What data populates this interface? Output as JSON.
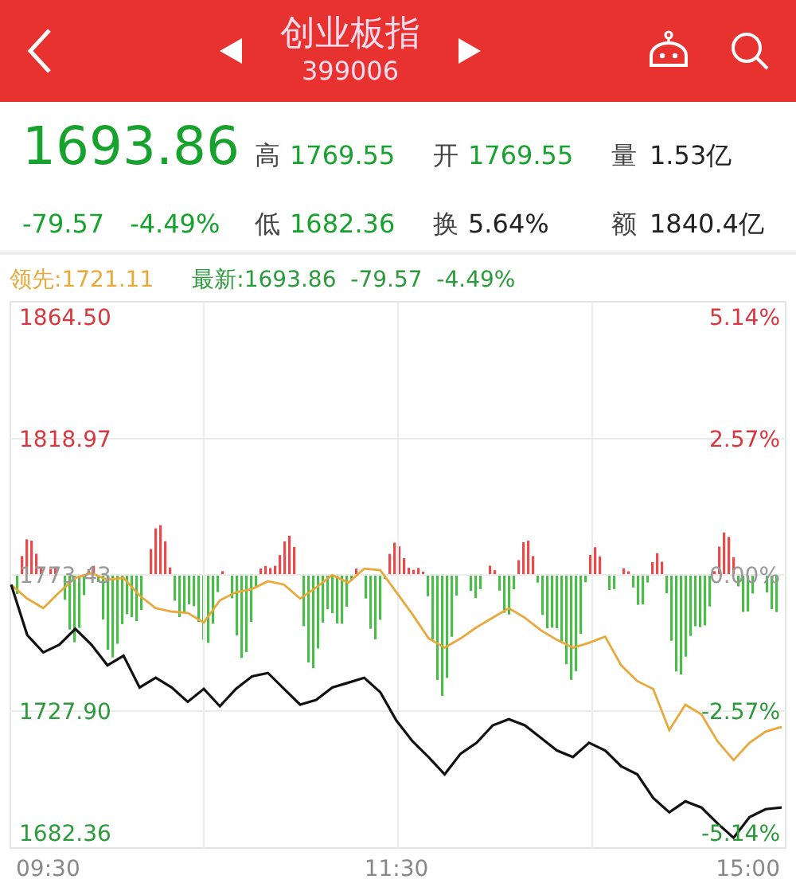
{
  "header": {
    "title": "创业板指",
    "code": "399006"
  },
  "quote": {
    "price": "1693.86",
    "change": "-79.57",
    "change_pct": "-4.49%",
    "color": "#17a22e",
    "stats": [
      {
        "label": "高",
        "value": "1769.55",
        "color": "#17a22e"
      },
      {
        "label": "开",
        "value": "1769.55",
        "color": "#17a22e"
      },
      {
        "label": "量",
        "value": "1.53亿",
        "color": "#222222"
      },
      {
        "label": "低",
        "value": "1682.36",
        "color": "#17a22e"
      },
      {
        "label": "换",
        "value": "5.64%",
        "color": "#222222"
      },
      {
        "label": "额",
        "value": "1840.4亿",
        "color": "#222222"
      }
    ]
  },
  "legend": [
    {
      "text": "领先:1721.11",
      "color": "#e8a93a"
    },
    {
      "text": "最新:1693.86  -79.57  -4.49%",
      "color": "#2a9a3a"
    }
  ],
  "chart": {
    "right_labels": [
      "5.14%",
      "2.57%",
      "0.00%",
      "-2.57%",
      "-5.14%"
    ],
    "chart_data": {
      "type": "line",
      "categories": [
        null,
        null,
        "09:30",
        null,
        null,
        null,
        null,
        null,
        null,
        null,
        null,
        null,
        null,
        null,
        null,
        null,
        null,
        null,
        null,
        null,
        null,
        null,
        null,
        null,
        "11:30",
        null,
        null,
        null,
        null,
        null,
        null,
        null,
        null,
        null,
        null,
        null,
        null,
        null,
        null,
        null,
        null,
        null,
        null,
        null,
        null,
        null,
        "15:00",
        null,
        null
      ],
      "ylim": [
        1682.36,
        1864.5
      ],
      "grid": true,
      "yticks": [
        {
          "value": 1864.5,
          "label": "1864.50"
        },
        {
          "value": 1818.97,
          "label": "1818.97"
        },
        {
          "value": 1773.43,
          "label": "1773.43"
        },
        {
          "value": 1727.9,
          "label": "1727.90"
        },
        {
          "value": 1682.36,
          "label": "1682.36"
        }
      ],
      "series": [
        {
          "color": "#e8a93a",
          "values": [
            1770.2,
            1765.5,
            1762.3,
            1767.6,
            1772.4,
            1774.0,
            1771.8,
            1772.4,
            1766.5,
            1762.3,
            1761.2,
            1760.7,
            1757.5,
            1764.9,
            1767.6,
            1768.7,
            1771.3,
            1770.2,
            1765.5,
            1769.2,
            1773.4,
            1770.8,
            1775.5,
            1775.0,
            1767.6,
            1760.2,
            1752.2,
            1749.1,
            1752.2,
            1755.9,
            1759.1,
            1762.3,
            1759.1,
            1754.9,
            1751.7,
            1749.1,
            1750.7,
            1752.8,
            1743.2,
            1737.9,
            1735.3,
            1721.5,
            1730.0,
            1726.8,
            1717.8,
            1711.5,
            1717.3,
            1721.0,
            1722.6
          ]
        },
        {
          "color": "#111111",
          "values": [
            1770.2,
            1753.3,
            1747.5,
            1750.1,
            1755.4,
            1750.1,
            1743.2,
            1746.4,
            1735.8,
            1739.0,
            1735.8,
            1731.0,
            1735.3,
            1729.5,
            1735.3,
            1739.5,
            1740.6,
            1735.3,
            1730.0,
            1731.6,
            1735.8,
            1737.4,
            1739.0,
            1734.2,
            1724.7,
            1717.8,
            1712.5,
            1706.7,
            1713.6,
            1717.3,
            1723.1,
            1725.2,
            1723.1,
            1718.9,
            1714.7,
            1712.5,
            1717.3,
            1714.7,
            1709.4,
            1706.7,
            1698.8,
            1694.0,
            1697.7,
            1695.6,
            1690.3,
            1685.5,
            1692.4,
            1695.1,
            1695.6
          ]
        }
      ]
    }
  }
}
